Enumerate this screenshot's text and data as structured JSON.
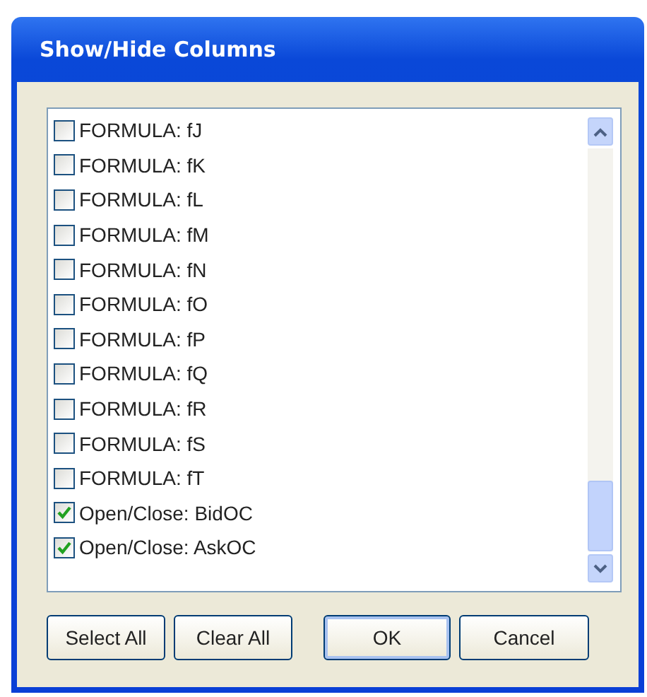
{
  "window": {
    "title": "Show/Hide Columns"
  },
  "items": [
    {
      "label": "FORMULA: fJ",
      "checked": false
    },
    {
      "label": "FORMULA: fK",
      "checked": false
    },
    {
      "label": "FORMULA: fL",
      "checked": false
    },
    {
      "label": "FORMULA: fM",
      "checked": false
    },
    {
      "label": "FORMULA: fN",
      "checked": false
    },
    {
      "label": "FORMULA: fO",
      "checked": false
    },
    {
      "label": "FORMULA: fP",
      "checked": false
    },
    {
      "label": "FORMULA: fQ",
      "checked": false
    },
    {
      "label": "FORMULA: fR",
      "checked": false
    },
    {
      "label": "FORMULA: fS",
      "checked": false
    },
    {
      "label": "FORMULA: fT",
      "checked": false
    },
    {
      "label": "Open/Close: BidOC",
      "checked": true
    },
    {
      "label": "Open/Close: AskOC",
      "checked": true
    }
  ],
  "buttons": [
    {
      "label": "Select All",
      "kind": "left"
    },
    {
      "label": "Clear All",
      "kind": "left"
    },
    {
      "label": "OK",
      "kind": "default"
    },
    {
      "label": "Cancel",
      "kind": "normal"
    }
  ]
}
